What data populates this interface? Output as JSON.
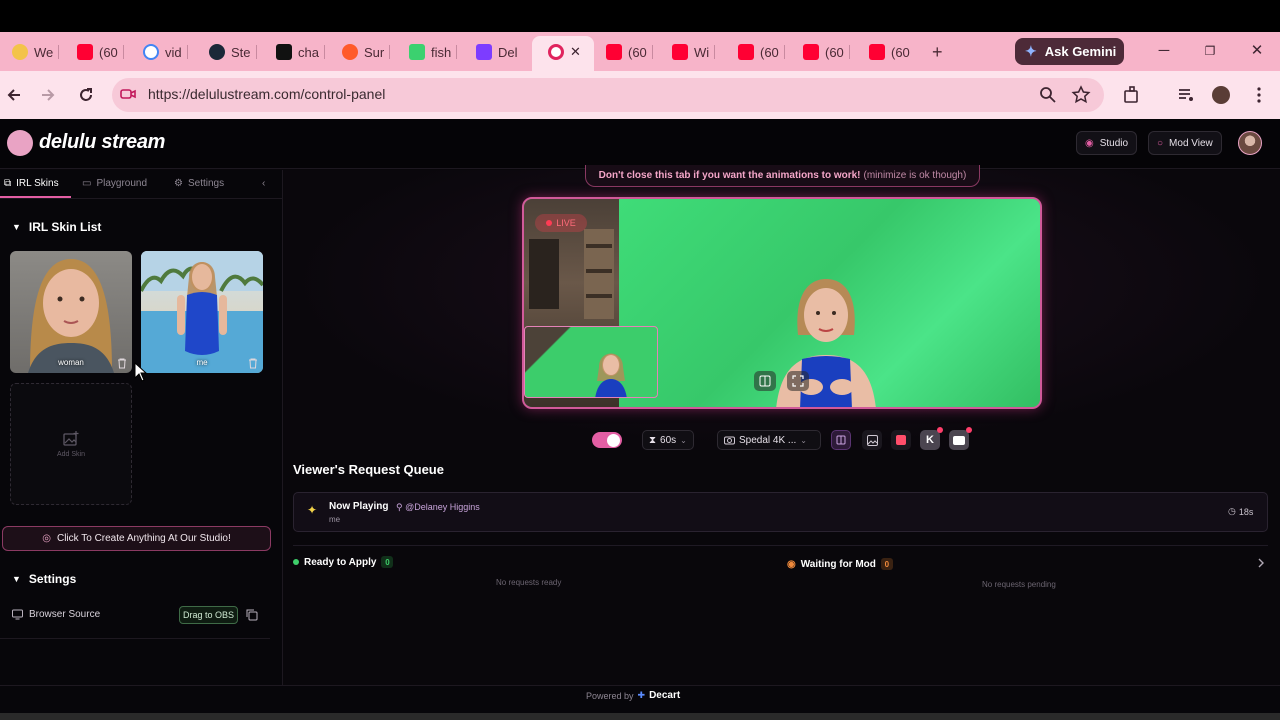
{
  "browser": {
    "tabs": [
      {
        "title": "We",
        "color": "#f3c34a"
      },
      {
        "title": "(60",
        "color": "#ff0033"
      },
      {
        "title": "vid",
        "color": "#4285f4"
      },
      {
        "title": "Ste",
        "color": "#1b2838"
      },
      {
        "title": "cha",
        "color": "#111111"
      },
      {
        "title": "Sur",
        "color": "#ff5a2a"
      },
      {
        "title": "fish",
        "color": "#3bd16f"
      },
      {
        "title": "Del",
        "color": "#7d3cff"
      },
      {
        "title": "",
        "color": "#e0245e"
      },
      {
        "title": "(60",
        "color": "#ff0033"
      },
      {
        "title": "Wi",
        "color": "#ff0033"
      },
      {
        "title": "(60",
        "color": "#ff0033"
      },
      {
        "title": "(60",
        "color": "#ff0033"
      },
      {
        "title": "(60",
        "color": "#ff0033"
      }
    ],
    "gemini_label": "Ask Gemini",
    "url": "https://delulustream.com/control-panel"
  },
  "app": {
    "logo_text": "delulu stream",
    "header_buttons": {
      "studio": "Studio",
      "mod_view": "Mod View"
    },
    "sidebar": {
      "tabs": [
        "IRL Skins",
        "Playground",
        "Settings"
      ],
      "skin_list_title": "IRL Skin List",
      "skins": [
        {
          "label": "woman"
        },
        {
          "label": "me"
        }
      ],
      "add_skin_label": "Add Skin",
      "create_button": "Click To Create Anything At Our Studio!",
      "settings_title": "Settings",
      "browser_source_label": "Browser Source",
      "drag_obs_label": "Drag to OBS"
    },
    "notice": {
      "main": "Don't close this tab if you want the animations to work!",
      "muted": "(minimize is ok though)"
    },
    "video": {
      "live_label": "LIVE"
    },
    "controls": {
      "timer": "60s",
      "camera": "Spedal 4K ..."
    },
    "queue": {
      "title": "Viewer's Request Queue",
      "now_playing_label": "Now Playing",
      "now_playing_user": "@Delaney Higgins",
      "now_playing_sub": "me",
      "now_playing_time": "18s",
      "ready_label": "Ready to Apply",
      "ready_count": "0",
      "ready_empty": "No requests ready",
      "waiting_label": "Waiting for Mod",
      "waiting_count": "0",
      "waiting_empty": "No requests pending"
    },
    "footer": {
      "powered_by": "Powered by",
      "brand": "Decart"
    },
    "colors": {
      "accent": "#e35ea4",
      "ready": "#3fcf6b",
      "waiting": "#f08a3c"
    }
  }
}
